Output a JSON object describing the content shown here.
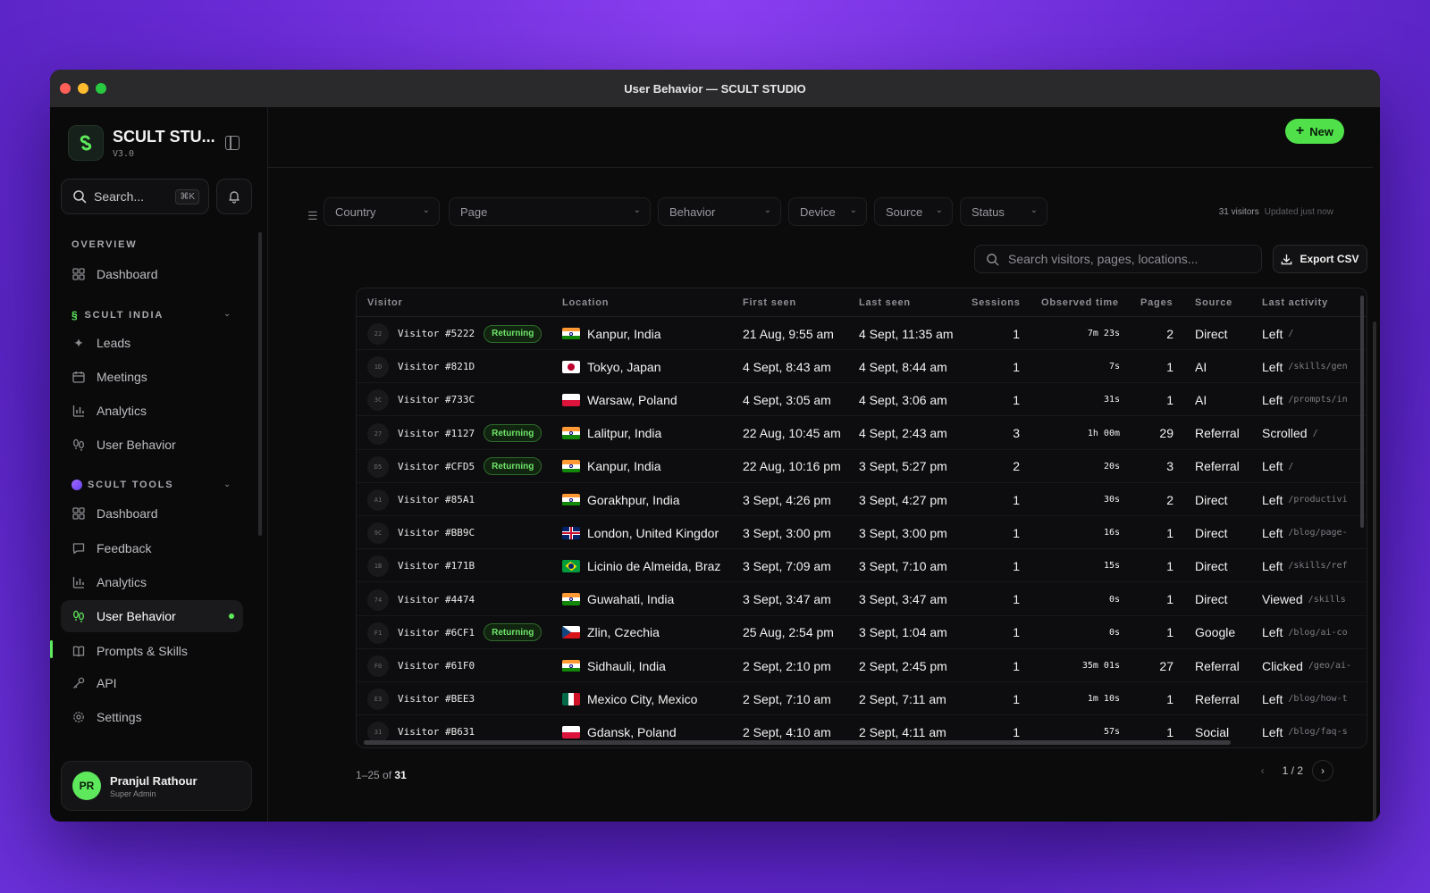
{
  "window": {
    "title": "User Behavior — SCULT STUDIO"
  },
  "brand": {
    "name": "SCULT STU...",
    "version": "V3.0"
  },
  "search": {
    "placeholder": "Search...",
    "shortcut": "⌘K"
  },
  "sidebar": {
    "overview_label": "OVERVIEW",
    "overview_items": [
      {
        "label": "Dashboard",
        "icon": "grid-icon"
      }
    ],
    "section1_label": "SCULT INDIA",
    "section1_items": [
      {
        "label": "Leads",
        "icon": "sparkle-icon"
      },
      {
        "label": "Meetings",
        "icon": "calendar-icon"
      },
      {
        "label": "Analytics",
        "icon": "bar-chart-icon"
      },
      {
        "label": "User Behavior",
        "icon": "footprints-icon"
      }
    ],
    "section2_label": "SCULT TOOLS",
    "section2_items": [
      {
        "label": "Dashboard",
        "icon": "grid-icon"
      },
      {
        "label": "Feedback",
        "icon": "message-icon"
      },
      {
        "label": "Analytics",
        "icon": "bar-chart-icon"
      },
      {
        "label": "User Behavior",
        "icon": "footprints-icon",
        "active": true
      },
      {
        "label": "Prompts & Skills",
        "icon": "book-icon"
      },
      {
        "label": "API",
        "icon": "key-icon"
      },
      {
        "label": "Settings",
        "icon": "gear-icon"
      }
    ]
  },
  "user": {
    "initials": "PR",
    "name": "Pranjul Rathour",
    "role": "Super Admin"
  },
  "toolbar": {
    "new_label": "New"
  },
  "filters": {
    "country": "Country",
    "page": "Page",
    "behavior": "Behavior",
    "device": "Device",
    "source": "Source",
    "status": "Status"
  },
  "meta": {
    "visitors": "31 visitors",
    "updated": "Updated just now"
  },
  "table_search": {
    "placeholder": "Search visitors, pages, locations..."
  },
  "export_label": "Export CSV",
  "table": {
    "headers": {
      "visitor": "Visitor",
      "location": "Location",
      "first_seen": "First seen",
      "last_seen": "Last seen",
      "sessions": "Sessions",
      "observed": "Observed time",
      "pages": "Pages",
      "source": "Source",
      "last_activity": "Last activity"
    },
    "rows": [
      {
        "idx": "22",
        "visitor": "Visitor #5222",
        "badge": "Returning",
        "flag": "in",
        "location": "Kanpur, India",
        "first": "21 Aug, 9:55 am",
        "last": "4 Sept, 11:35 am",
        "sessions": "1",
        "observed": "7m 23s",
        "pages": "2",
        "source": "Direct",
        "act": "Left",
        "path": "/"
      },
      {
        "idx": "1D",
        "visitor": "Visitor #821D",
        "badge": "",
        "flag": "jp",
        "location": "Tokyo, Japan",
        "first": "4 Sept, 8:43 am",
        "last": "4 Sept, 8:44 am",
        "sessions": "1",
        "observed": "7s",
        "pages": "1",
        "source": "AI",
        "act": "Left",
        "path": "/skills/gen"
      },
      {
        "idx": "3C",
        "visitor": "Visitor #733C",
        "badge": "",
        "flag": "pl",
        "location": "Warsaw, Poland",
        "first": "4 Sept, 3:05 am",
        "last": "4 Sept, 3:06 am",
        "sessions": "1",
        "observed": "31s",
        "pages": "1",
        "source": "AI",
        "act": "Left",
        "path": "/prompts/in"
      },
      {
        "idx": "27",
        "visitor": "Visitor #1127",
        "badge": "Returning",
        "flag": "in",
        "location": "Lalitpur, India",
        "first": "22 Aug, 10:45 am",
        "last": "4 Sept, 2:43 am",
        "sessions": "3",
        "observed": "1h 00m",
        "pages": "29",
        "source": "Referral",
        "act": "Scrolled",
        "path": "/"
      },
      {
        "idx": "D5",
        "visitor": "Visitor #CFD5",
        "badge": "Returning",
        "flag": "in",
        "location": "Kanpur, India",
        "first": "22 Aug, 10:16 pm",
        "last": "3 Sept, 5:27 pm",
        "sessions": "2",
        "observed": "20s",
        "pages": "3",
        "source": "Referral",
        "act": "Left",
        "path": "/"
      },
      {
        "idx": "A1",
        "visitor": "Visitor #85A1",
        "badge": "",
        "flag": "in",
        "location": "Gorakhpur, India",
        "first": "3 Sept, 4:26 pm",
        "last": "3 Sept, 4:27 pm",
        "sessions": "1",
        "observed": "30s",
        "pages": "2",
        "source": "Direct",
        "act": "Left",
        "path": "/productivi"
      },
      {
        "idx": "9C",
        "visitor": "Visitor #BB9C",
        "badge": "",
        "flag": "gb",
        "location": "London, United Kingdor",
        "first": "3 Sept, 3:00 pm",
        "last": "3 Sept, 3:00 pm",
        "sessions": "1",
        "observed": "16s",
        "pages": "1",
        "source": "Direct",
        "act": "Left",
        "path": "/blog/page-"
      },
      {
        "idx": "1B",
        "visitor": "Visitor #171B",
        "badge": "",
        "flag": "br",
        "location": "Licinio de Almeida, Braz",
        "first": "3 Sept, 7:09 am",
        "last": "3 Sept, 7:10 am",
        "sessions": "1",
        "observed": "15s",
        "pages": "1",
        "source": "Direct",
        "act": "Left",
        "path": "/skills/ref"
      },
      {
        "idx": "74",
        "visitor": "Visitor #4474",
        "badge": "",
        "flag": "in",
        "location": "Guwahati, India",
        "first": "3 Sept, 3:47 am",
        "last": "3 Sept, 3:47 am",
        "sessions": "1",
        "observed": "0s",
        "pages": "1",
        "source": "Direct",
        "act": "Viewed",
        "path": "/skills"
      },
      {
        "idx": "F1",
        "visitor": "Visitor #6CF1",
        "badge": "Returning",
        "flag": "cz",
        "location": "Zlin, Czechia",
        "first": "25 Aug, 2:54 pm",
        "last": "3 Sept, 1:04 am",
        "sessions": "1",
        "observed": "0s",
        "pages": "1",
        "source": "Google",
        "act": "Left",
        "path": "/blog/ai-co"
      },
      {
        "idx": "F0",
        "visitor": "Visitor #61F0",
        "badge": "",
        "flag": "in",
        "location": "Sidhauli, India",
        "first": "2 Sept, 2:10 pm",
        "last": "2 Sept, 2:45 pm",
        "sessions": "1",
        "observed": "35m 01s",
        "pages": "27",
        "source": "Referral",
        "act": "Clicked",
        "path": "/geo/ai-"
      },
      {
        "idx": "E3",
        "visitor": "Visitor #BEE3",
        "badge": "",
        "flag": "mx",
        "location": "Mexico City, Mexico",
        "first": "2 Sept, 7:10 am",
        "last": "2 Sept, 7:11 am",
        "sessions": "1",
        "observed": "1m 10s",
        "pages": "1",
        "source": "Referral",
        "act": "Left",
        "path": "/blog/how-t"
      },
      {
        "idx": "31",
        "visitor": "Visitor #B631",
        "badge": "",
        "flag": "pl",
        "location": "Gdansk, Poland",
        "first": "2 Sept, 4:10 am",
        "last": "2 Sept, 4:11 am",
        "sessions": "1",
        "observed": "57s",
        "pages": "1",
        "source": "Social",
        "act": "Left",
        "path": "/blog/faq-s"
      }
    ]
  },
  "pagination": {
    "range": "1–25 of",
    "total": "31",
    "page": "1 / 2"
  },
  "colors": {
    "accent": "#4fe04a",
    "bg": "#0b0b0c",
    "badge_text": "#6ee56a"
  }
}
